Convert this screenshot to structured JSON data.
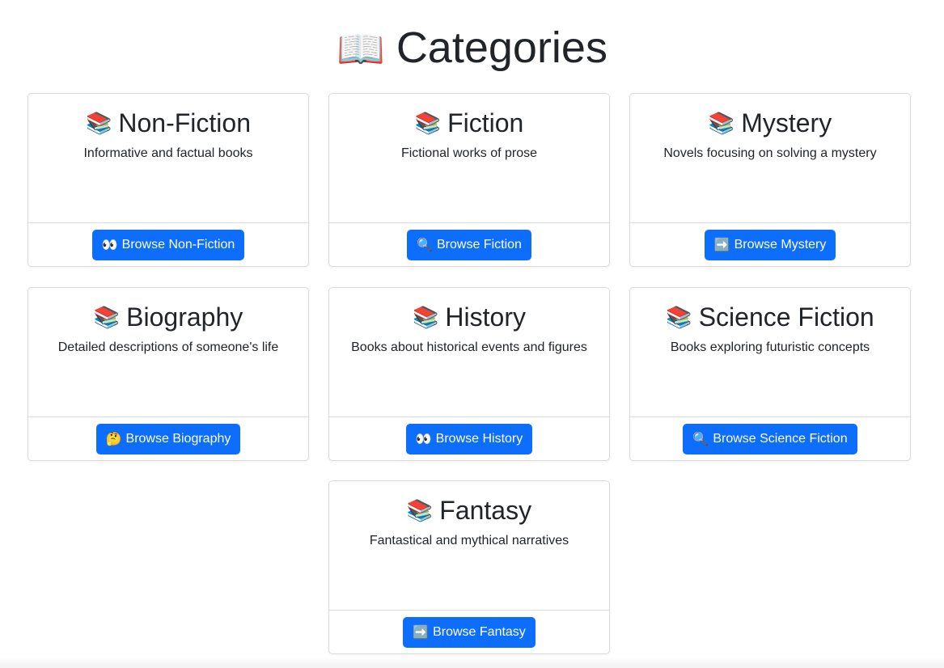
{
  "page": {
    "title": "Categories",
    "title_icon": "📖"
  },
  "colors": {
    "button_primary": "#0d6efd",
    "card_border": "#d9dcdf",
    "text": "#212529"
  },
  "categories": [
    {
      "icon": "📚",
      "icon_name": "books-icon",
      "title": "Non-Fiction",
      "description": "Informative and factual books",
      "button_icon": "👀",
      "button_icon_name": "eyes-icon",
      "button_label": "Browse Non-Fiction"
    },
    {
      "icon": "📚",
      "icon_name": "books-icon",
      "title": "Fiction",
      "description": "Fictional works of prose",
      "button_icon": "🔍",
      "button_icon_name": "magnifier-icon",
      "button_label": "Browse Fiction"
    },
    {
      "icon": "📚",
      "icon_name": "books-icon",
      "title": "Mystery",
      "description": "Novels focusing on solving a mystery",
      "button_icon": "➡️",
      "button_icon_name": "right-arrow-icon",
      "button_label": "Browse Mystery"
    },
    {
      "icon": "📚",
      "icon_name": "books-icon",
      "title": "Biography",
      "description": "Detailed descriptions of someone's life",
      "button_icon": "🤔",
      "button_icon_name": "thinking-face-icon",
      "button_label": "Browse Biography"
    },
    {
      "icon": "📚",
      "icon_name": "books-icon",
      "title": "History",
      "description": "Books about historical events and figures",
      "button_icon": "👀",
      "button_icon_name": "eyes-icon",
      "button_label": "Browse History"
    },
    {
      "icon": "📚",
      "icon_name": "books-icon",
      "title": "Science Fiction",
      "description": "Books exploring futuristic concepts",
      "button_icon": "🔍",
      "button_icon_name": "magnifier-icon",
      "button_label": "Browse Science Fiction"
    },
    {
      "icon": "📚",
      "icon_name": "books-icon",
      "title": "Fantasy",
      "description": "Fantastical and mythical narratives",
      "button_icon": "➡️",
      "button_icon_name": "right-arrow-icon",
      "button_label": "Browse Fantasy"
    }
  ]
}
